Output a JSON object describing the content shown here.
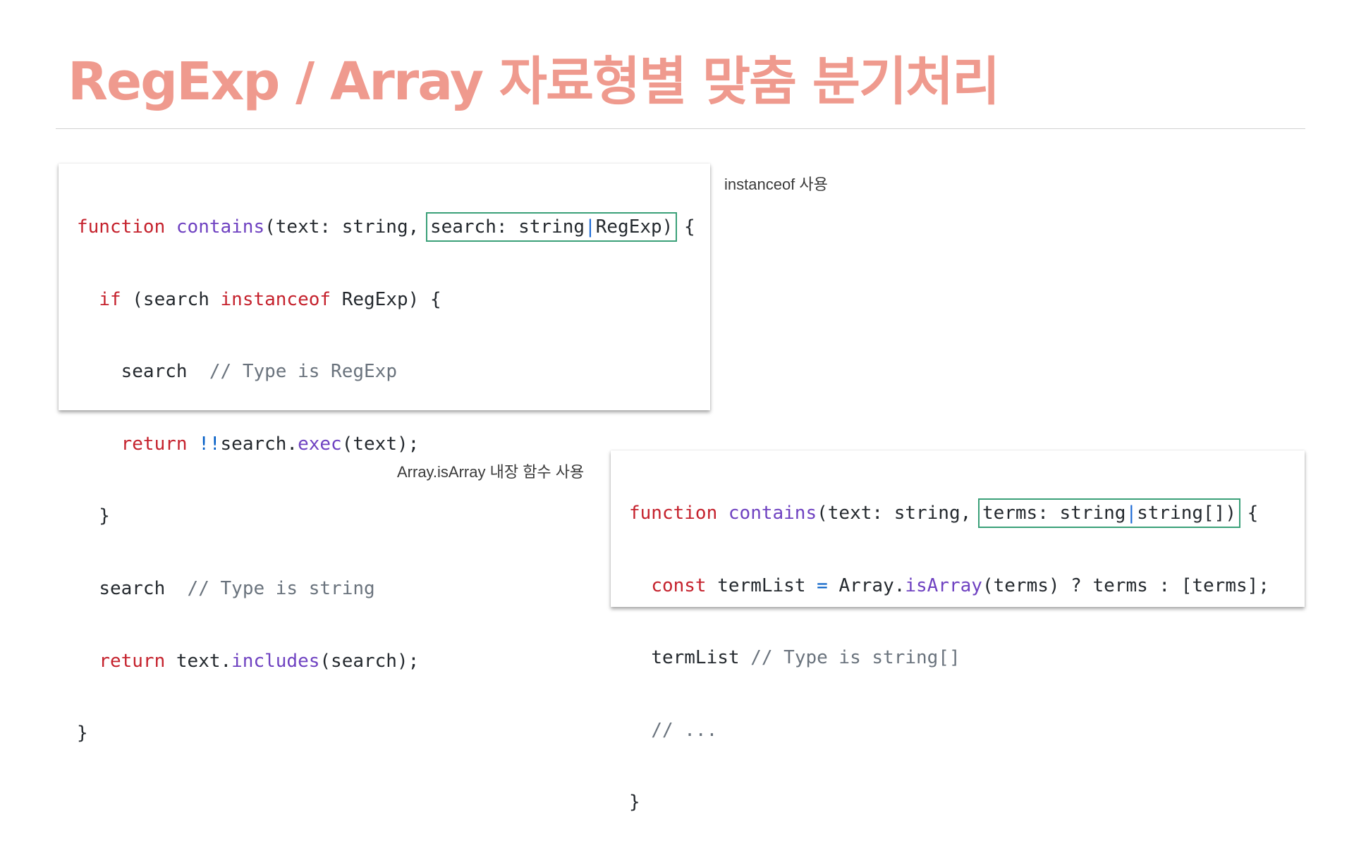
{
  "title": "RegExp / Array 자료형별 맞춤 분기처리",
  "notes": {
    "instanceof": "instanceof 사용",
    "isarray": "Array.isArray 내장 함수 사용"
  },
  "snippet1": {
    "l1": {
      "kw": "function",
      "fn": "contains",
      "pre": "(text: string,",
      "hl_a": "search: string",
      "bar": "|",
      "hl_b": "RegExp)",
      "post": " {"
    },
    "l2": {
      "indent": "  ",
      "kw": "if",
      "mid": " (search ",
      "kw2": "instanceof",
      "post": " RegExp) {"
    },
    "l3": {
      "indent": "    ",
      "text": "search",
      "gap": "  ",
      "cm": "// Type is RegExp"
    },
    "l4": {
      "indent": "    ",
      "kw": "return",
      "op": " !!",
      "pre": "search.",
      "fn": "exec",
      "post": "(text);"
    },
    "l5": {
      "text": "  }"
    },
    "l6": {
      "indent": "  ",
      "text": "search",
      "gap": "  ",
      "cm": "// Type is string"
    },
    "l7": {
      "indent": "  ",
      "kw": "return",
      "pre": " text.",
      "fn": "includes",
      "post": "(search);"
    },
    "l8": {
      "text": "}"
    }
  },
  "snippet2": {
    "l1": {
      "kw": "function",
      "fn": "contains",
      "pre": "(text: string,",
      "hl_a": "terms: string",
      "bar": "|",
      "hl_b": "string[])",
      "post": " {"
    },
    "l2": {
      "indent": "  ",
      "kw": "const",
      "pre": " termList ",
      "op": "=",
      "mid": " Array.",
      "fn": "isArray",
      "post": "(terms) ? terms : [terms];"
    },
    "l3": {
      "indent": "  ",
      "text": "termList ",
      "cm": "// Type is string[]"
    },
    "l4": {
      "indent": "  ",
      "cm": "// ..."
    },
    "l5": {
      "text": "}"
    }
  },
  "colors": {
    "title": "#ef9a8e",
    "keyword": "#c5222d",
    "function": "#6f42c1",
    "comment": "#6a737d",
    "highlight_border": "#3aa078"
  }
}
